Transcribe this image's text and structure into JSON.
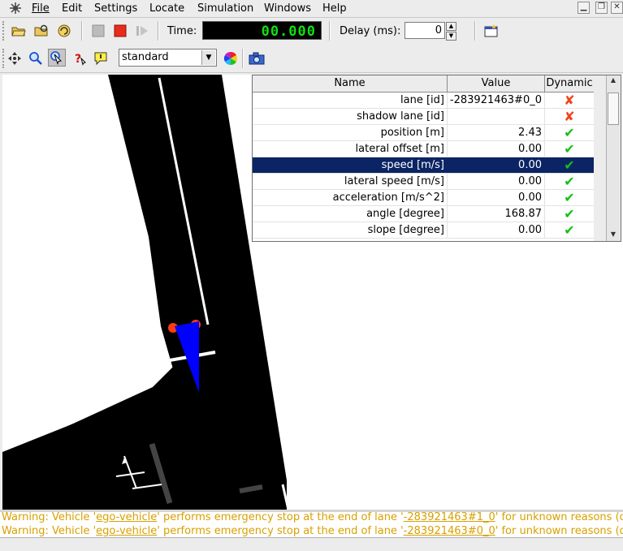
{
  "menubar": {
    "items": [
      {
        "label": "File"
      },
      {
        "label": "Edit"
      },
      {
        "label": "Settings"
      },
      {
        "label": "Locate"
      },
      {
        "label": "Simulation"
      },
      {
        "label": "Windows"
      },
      {
        "label": "Help"
      }
    ],
    "window_controls": [
      "minimize",
      "restore",
      "close"
    ]
  },
  "toolbar": {
    "time_label": "Time:",
    "time_value": "00.000",
    "delay_label": "Delay (ms):",
    "delay_value": "0"
  },
  "view_toolbar": {
    "scheme_value": "standard"
  },
  "param_table": {
    "columns": [
      "Name",
      "Value",
      "Dynamic"
    ],
    "rows": [
      {
        "name": "lane [id]",
        "value": "-283921463#0_0",
        "dynamic": false
      },
      {
        "name": "shadow lane [id]",
        "value": "",
        "dynamic": false
      },
      {
        "name": "position [m]",
        "value": "2.43",
        "dynamic": true
      },
      {
        "name": "lateral offset [m]",
        "value": "0.00",
        "dynamic": true
      },
      {
        "name": "speed [m/s]",
        "value": "0.00",
        "dynamic": true,
        "selected": true
      },
      {
        "name": "lateral speed [m/s]",
        "value": "0.00",
        "dynamic": true
      },
      {
        "name": "acceleration [m/s^2]",
        "value": "0.00",
        "dynamic": true
      },
      {
        "name": "angle [degree]",
        "value": "168.87",
        "dynamic": true
      },
      {
        "name": "slope [degree]",
        "value": "0.00",
        "dynamic": true
      }
    ]
  },
  "log": {
    "lines": [
      {
        "prefix": "Warning: Vehicle '",
        "vehicle": "ego-vehicle",
        "middle": "' performs emergency stop at the end of lane '",
        "lane": "-283921463#1_0",
        "suffix": "' for unknown reasons (de"
      },
      {
        "prefix": "Warning: Vehicle '",
        "vehicle": "ego-vehicle",
        "middle": "' performs emergency stop at the end of lane '",
        "lane": "-283921463#0_0",
        "suffix": "' for unknown reasons (de"
      }
    ]
  },
  "colors": {
    "selection": "#0b2463",
    "warning_text": "#d8a000",
    "vehicle": "#0000ff",
    "road": "#000000",
    "lcd_text": "#10e010"
  }
}
